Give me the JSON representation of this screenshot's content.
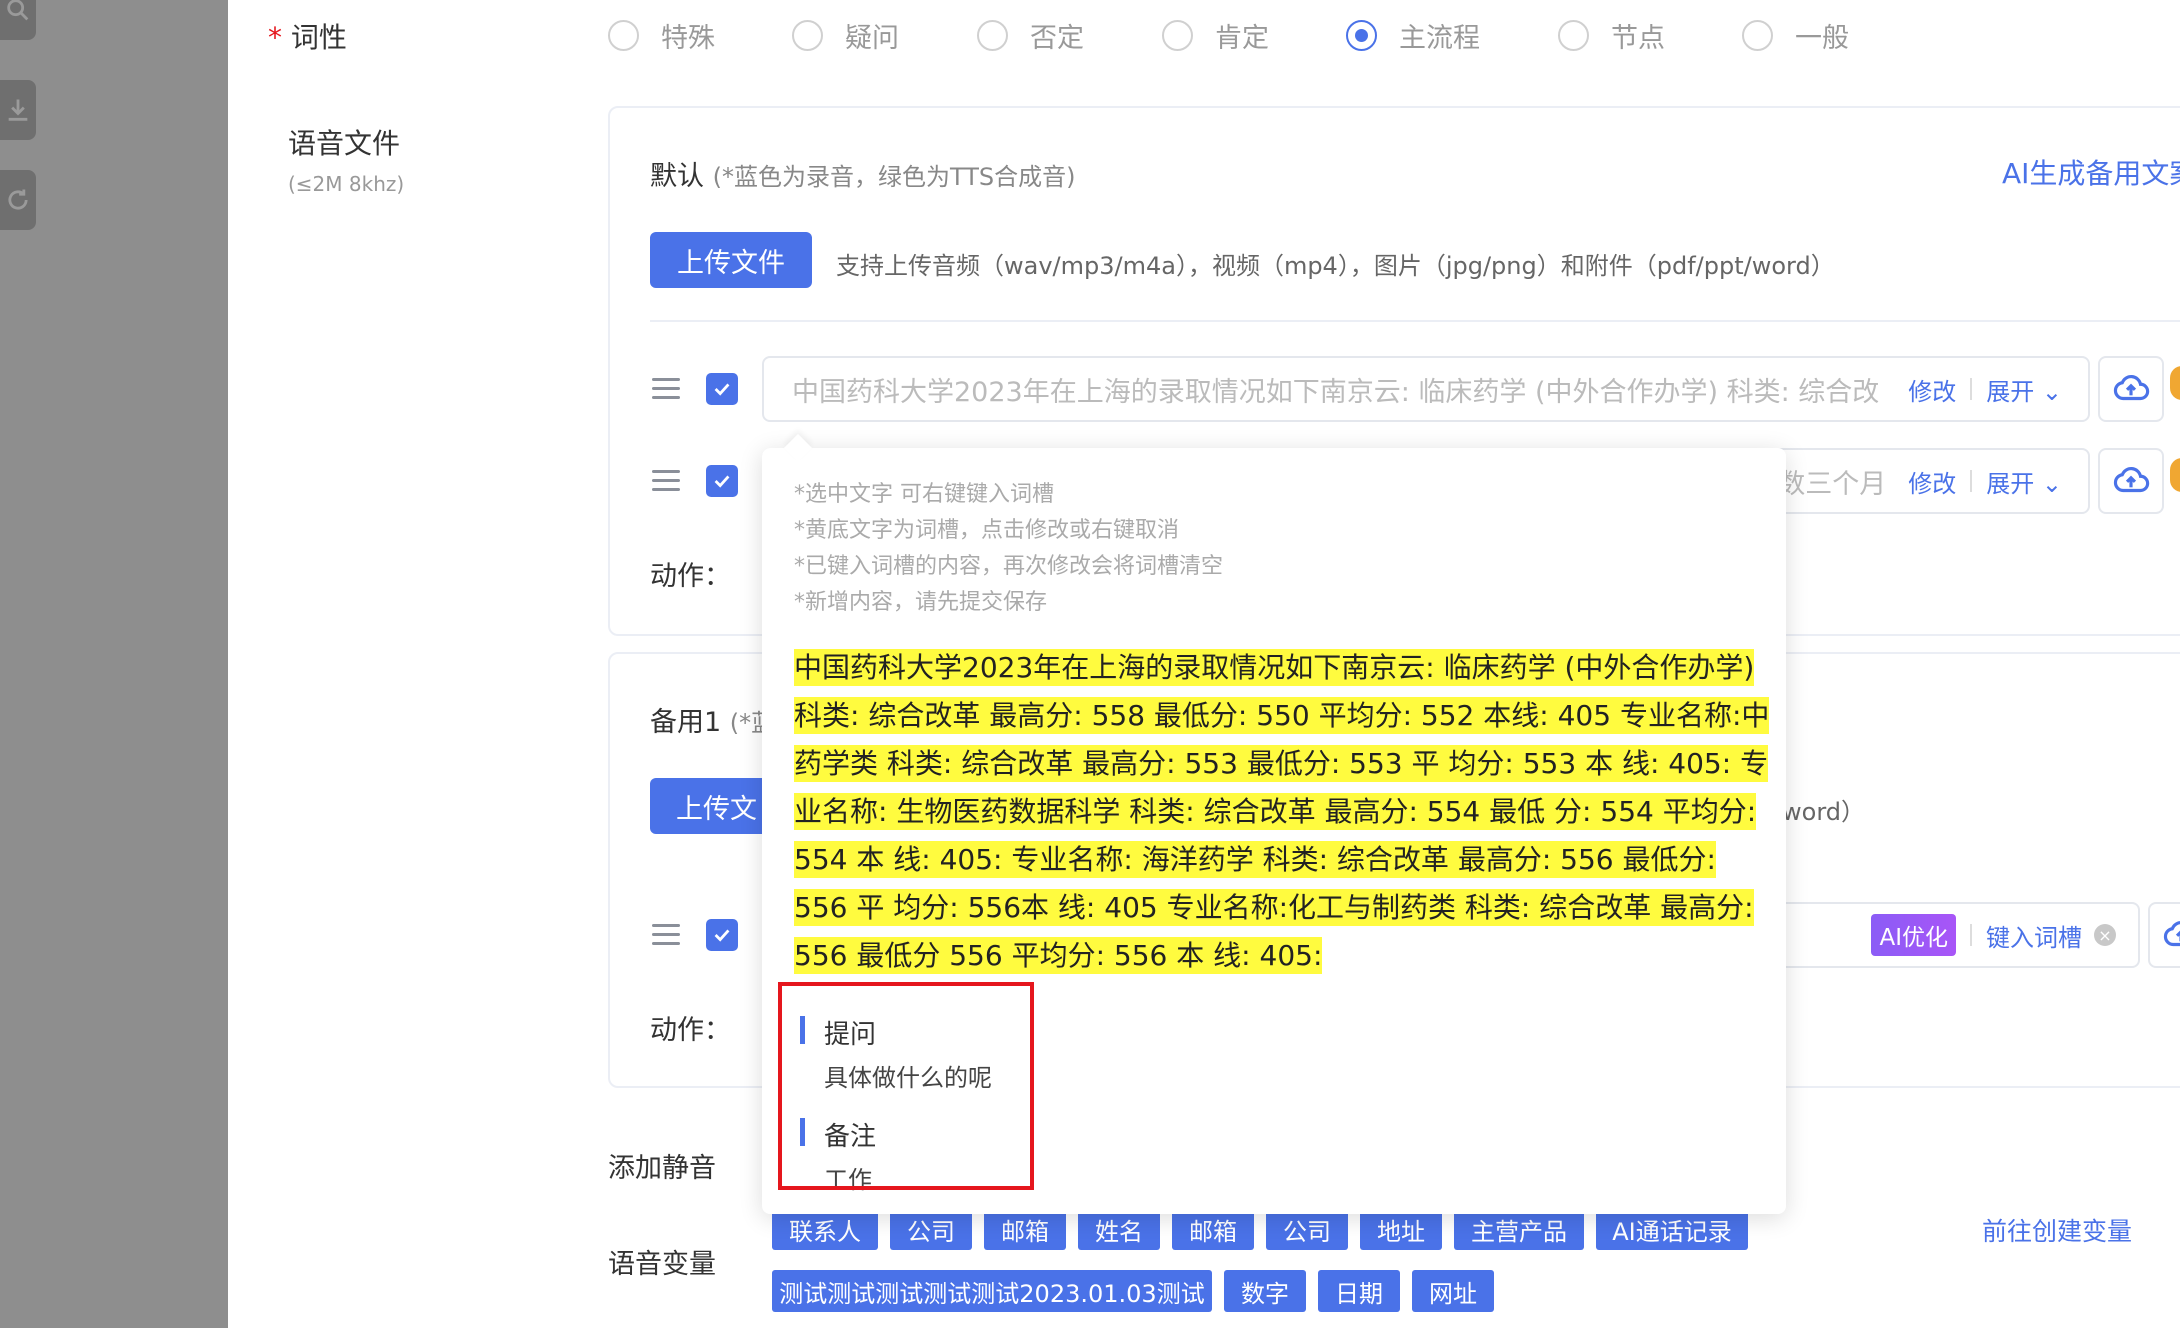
{
  "sidebar": {
    "icons": [
      "search-icon",
      "download-icon",
      "refresh-icon"
    ]
  },
  "pos_field": {
    "required_mark": "*",
    "label": "词性",
    "options": [
      "特殊",
      "疑问",
      "否定",
      "肯定",
      "主流程",
      "节点",
      "一般"
    ],
    "selected": "主流程"
  },
  "voice_file": {
    "label": "语音文件",
    "sublabel": "(≤2M 8khz)"
  },
  "default_card": {
    "title": "默认",
    "subtitle": "(*蓝色为录音，绿色为TTS合成音)",
    "ai_link": "AI生成备用文案",
    "upload_label": "上传文件",
    "upload_hint": "支持上传音频（wav/mp3/m4a），视频（mp4），图片（jpg/png）和附件（pdf/ppt/word）",
    "row1_text": "中国药科大学2023年在上海的录取情况如下南京云: 临床药学 (中外合作办学) 科类: 综合改",
    "row2_text": "数三个月",
    "modify": "修改",
    "expand": "展开",
    "action_label": "动作："
  },
  "backup_card": {
    "title": "备用1",
    "subtitle": "(*蓝",
    "upload_label": "上传文",
    "upload_hint_tail": "word）",
    "ai_optimize": "AI优化",
    "insert_slot": "键入词槽",
    "action_label": "动作："
  },
  "popover": {
    "tips": [
      "*选中文字 可右键键入词槽",
      "*黄底文字为词槽，点击修改或右键取消",
      "*已键入词槽的内容，再次修改会将词槽清空",
      "*新增内容，请先提交保存"
    ],
    "highlighted_lines": [
      "中国药科大学2023年在上海的录取情况如下南京云: 临床药学 (中外合作办学)",
      "科类: 综合改革 最高分: 558 最低分: 550 平均分: 552 本线: 405 专业名称:中",
      "药学类 科类: 综合改革 最高分: 553 最低分: 553 平 均分: 553 本 线: 405: 专",
      "业名称: 生物医药数据科学 科类: 综合改革 最高分: 554 最低 分: 554 平均分:",
      "554 本 线: 405: 专业名称: 海洋药学 科类: 综合改革 最高分: 556 最低分:",
      "556 平 均分: 556本 线: 405 专业名称:化工与制药类 科类: 综合改革 最高分:",
      "556 最低分 556 平均分: 556 本 线: 405:"
    ],
    "question_title": "提问",
    "question_text": "具体做什么的呢",
    "note_title": "备注",
    "note_text": "工作"
  },
  "silence": {
    "label": "添加静音"
  },
  "variables": {
    "label": "语音变量",
    "create_link": "前往创建变量",
    "row1": [
      "联系人",
      "公司",
      "邮箱",
      "姓名",
      "邮箱",
      "公司",
      "地址",
      "主营产品",
      "AI通话记录"
    ],
    "row2": [
      "测试测试测试测试测试2023.01.03测试",
      "数字",
      "日期",
      "网址"
    ]
  },
  "colors": {
    "primary": "#4a72e8",
    "highlight": "#fffb3f",
    "annotation_red": "#e5161d",
    "rail": "#8e8e8e"
  }
}
